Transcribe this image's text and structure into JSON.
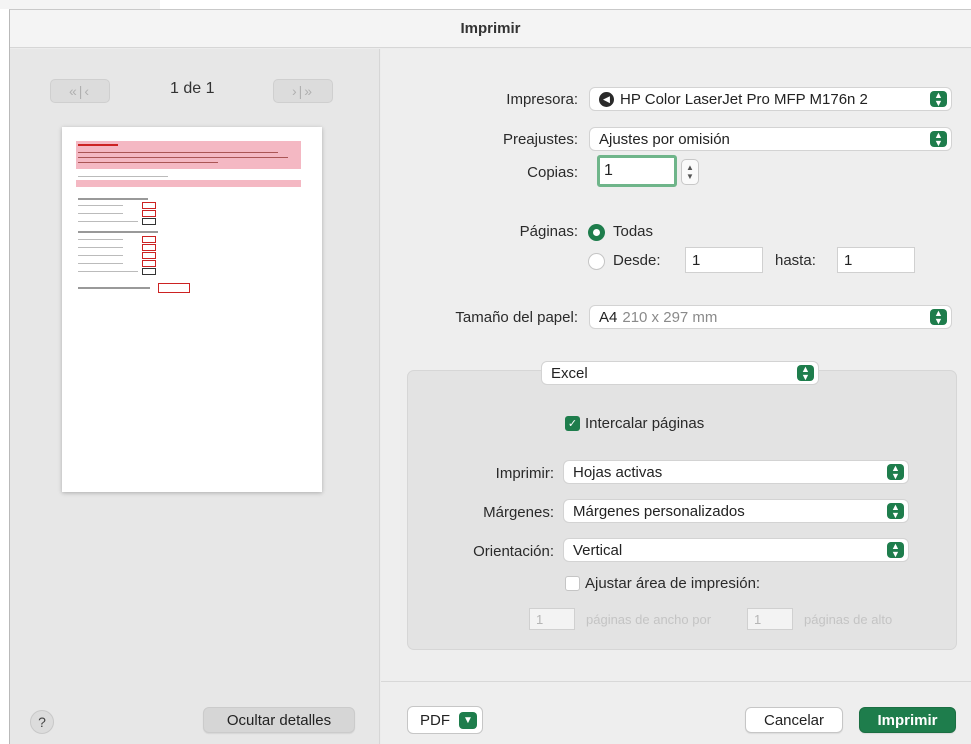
{
  "window": {
    "title": "Imprimir"
  },
  "preview": {
    "first_icon": "«|",
    "prev_icon": "‹",
    "next_icon": "›",
    "last_icon": "|»",
    "page_count": "1 de 1"
  },
  "printer": {
    "label": "Impresora:",
    "value": "HP Color LaserJet Pro MFP M176n 2"
  },
  "presets": {
    "label": "Preajustes:",
    "value": "Ajustes por omisión"
  },
  "copies": {
    "label": "Copias:",
    "value": "1"
  },
  "pages": {
    "label": "Páginas:",
    "all_label": "Todas",
    "from_label": "Desde:",
    "from_value": "1",
    "to_label": "hasta:",
    "to_value": "1",
    "selected": "Todas"
  },
  "paper": {
    "label": "Tamaño del papel:",
    "value": "A4",
    "detail": "210 x 297 mm"
  },
  "app_section": {
    "value": "Excel"
  },
  "excel": {
    "collate_label": "Intercalar páginas",
    "collate_checked": true,
    "print_label": "Imprimir:",
    "print_value": "Hojas activas",
    "margins_label": "Márgenes:",
    "margins_value": "Márgenes personalizados",
    "orientation_label": "Orientación:",
    "orientation_value": "Vertical",
    "fit_label": "Ajustar área de impresión:",
    "fit_checked": false,
    "wide_value": "1",
    "wide_label": "páginas de ancho por",
    "tall_value": "1",
    "tall_label": "páginas de alto"
  },
  "footer": {
    "help_label": "?",
    "hide_details_label": "Ocultar detalles",
    "pdf_label": "PDF",
    "cancel_label": "Cancelar",
    "print_label": "Imprimir"
  },
  "colors": {
    "accent": "#1e7d4c",
    "preview_highlight": "#f4b8c3"
  }
}
